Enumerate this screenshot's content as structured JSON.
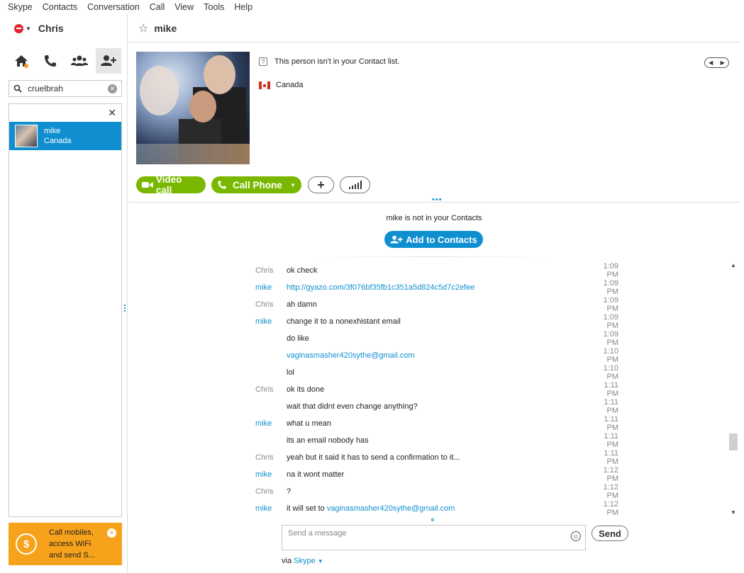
{
  "menu": [
    "Skype",
    "Contacts",
    "Conversation",
    "Call",
    "View",
    "Tools",
    "Help"
  ],
  "user": {
    "name": "Chris"
  },
  "search": {
    "value": "cruelbrah"
  },
  "results": [
    {
      "name": "mike",
      "location": "Canada"
    }
  ],
  "promo": {
    "line1": "Call mobiles,",
    "line2": "access WiFi",
    "line3": "and send S..."
  },
  "conversation": {
    "title": "mike",
    "contact_status": "This person isn't in your Contact list.",
    "country": "Canada",
    "buttons": {
      "video": "Video call",
      "phone": "Call Phone"
    },
    "not_in_contacts": "mike is not in your Contacts",
    "add_contacts": "Add to Contacts"
  },
  "messages": [
    {
      "sender": "Chris",
      "text": "ok check",
      "time": "1:09 PM"
    },
    {
      "sender": "mike",
      "text": "",
      "link": "http://gyazo.com/3f076bf35fb1c351a5d824c5d7c2efee",
      "time": "1:09 PM"
    },
    {
      "sender": "Chris",
      "text": "ah damn",
      "time": "1:09 PM"
    },
    {
      "sender": "mike",
      "text": "change it to a nonexhistant email",
      "time": "1:09 PM"
    },
    {
      "sender": "",
      "text": "do like",
      "time": "1:09 PM"
    },
    {
      "sender": "",
      "text": "",
      "link": "vaginasmasher420sythe@gmail.com",
      "time": "1:10 PM"
    },
    {
      "sender": "",
      "text": "lol",
      "time": "1:10 PM"
    },
    {
      "sender": "Chris",
      "text": "ok its done",
      "time": "1:11 PM"
    },
    {
      "sender": "",
      "text": "wait that didnt even change anything?",
      "time": "1:11 PM"
    },
    {
      "sender": "mike",
      "text": "what u mean",
      "time": "1:11 PM"
    },
    {
      "sender": "",
      "text": "its an email nobody has",
      "time": "1:11 PM"
    },
    {
      "sender": "Chris",
      "text": "yeah but it said it has to send a confirmation to it...",
      "time": "1:11 PM"
    },
    {
      "sender": "mike",
      "text": "na it wont matter",
      "time": "1:12 PM"
    },
    {
      "sender": "Chris",
      "text": "?",
      "time": "1:12 PM"
    },
    {
      "sender": "mike",
      "text": "it will set to ",
      "link": "vaginasmasher420sythe@gmail.com",
      "time": "1:12 PM"
    }
  ],
  "composer": {
    "placeholder": "Send a message",
    "send": "Send",
    "via_prefix": "via",
    "via_service": "Skype"
  },
  "colors": {
    "accent": "#0f8fd0",
    "call_green": "#7ab800",
    "promo": "#f7a21b",
    "status_red": "#e0252f"
  }
}
